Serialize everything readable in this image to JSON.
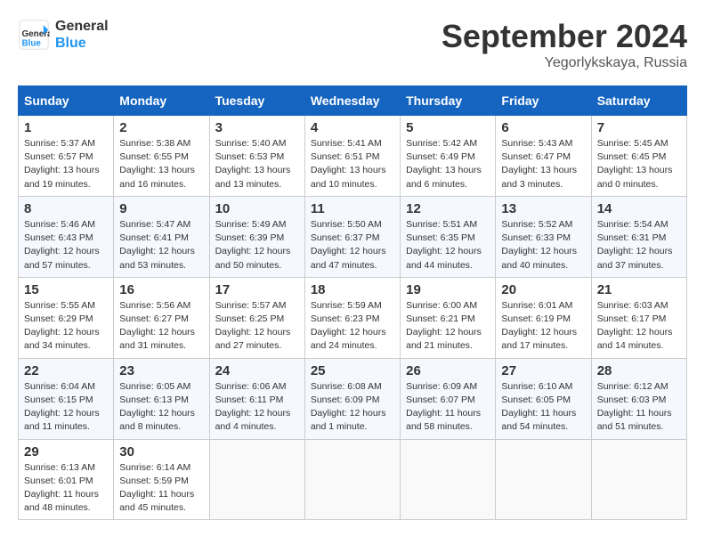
{
  "logo": {
    "text_general": "General",
    "text_blue": "Blue"
  },
  "title": "September 2024",
  "location": "Yegorlykskaya, Russia",
  "days_of_week": [
    "Sunday",
    "Monday",
    "Tuesday",
    "Wednesday",
    "Thursday",
    "Friday",
    "Saturday"
  ],
  "weeks": [
    [
      {
        "day": "1",
        "info": "Sunrise: 5:37 AM\nSunset: 6:57 PM\nDaylight: 13 hours and 19 minutes."
      },
      {
        "day": "2",
        "info": "Sunrise: 5:38 AM\nSunset: 6:55 PM\nDaylight: 13 hours and 16 minutes."
      },
      {
        "day": "3",
        "info": "Sunrise: 5:40 AM\nSunset: 6:53 PM\nDaylight: 13 hours and 13 minutes."
      },
      {
        "day": "4",
        "info": "Sunrise: 5:41 AM\nSunset: 6:51 PM\nDaylight: 13 hours and 10 minutes."
      },
      {
        "day": "5",
        "info": "Sunrise: 5:42 AM\nSunset: 6:49 PM\nDaylight: 13 hours and 6 minutes."
      },
      {
        "day": "6",
        "info": "Sunrise: 5:43 AM\nSunset: 6:47 PM\nDaylight: 13 hours and 3 minutes."
      },
      {
        "day": "7",
        "info": "Sunrise: 5:45 AM\nSunset: 6:45 PM\nDaylight: 13 hours and 0 minutes."
      }
    ],
    [
      {
        "day": "8",
        "info": "Sunrise: 5:46 AM\nSunset: 6:43 PM\nDaylight: 12 hours and 57 minutes."
      },
      {
        "day": "9",
        "info": "Sunrise: 5:47 AM\nSunset: 6:41 PM\nDaylight: 12 hours and 53 minutes."
      },
      {
        "day": "10",
        "info": "Sunrise: 5:49 AM\nSunset: 6:39 PM\nDaylight: 12 hours and 50 minutes."
      },
      {
        "day": "11",
        "info": "Sunrise: 5:50 AM\nSunset: 6:37 PM\nDaylight: 12 hours and 47 minutes."
      },
      {
        "day": "12",
        "info": "Sunrise: 5:51 AM\nSunset: 6:35 PM\nDaylight: 12 hours and 44 minutes."
      },
      {
        "day": "13",
        "info": "Sunrise: 5:52 AM\nSunset: 6:33 PM\nDaylight: 12 hours and 40 minutes."
      },
      {
        "day": "14",
        "info": "Sunrise: 5:54 AM\nSunset: 6:31 PM\nDaylight: 12 hours and 37 minutes."
      }
    ],
    [
      {
        "day": "15",
        "info": "Sunrise: 5:55 AM\nSunset: 6:29 PM\nDaylight: 12 hours and 34 minutes."
      },
      {
        "day": "16",
        "info": "Sunrise: 5:56 AM\nSunset: 6:27 PM\nDaylight: 12 hours and 31 minutes."
      },
      {
        "day": "17",
        "info": "Sunrise: 5:57 AM\nSunset: 6:25 PM\nDaylight: 12 hours and 27 minutes."
      },
      {
        "day": "18",
        "info": "Sunrise: 5:59 AM\nSunset: 6:23 PM\nDaylight: 12 hours and 24 minutes."
      },
      {
        "day": "19",
        "info": "Sunrise: 6:00 AM\nSunset: 6:21 PM\nDaylight: 12 hours and 21 minutes."
      },
      {
        "day": "20",
        "info": "Sunrise: 6:01 AM\nSunset: 6:19 PM\nDaylight: 12 hours and 17 minutes."
      },
      {
        "day": "21",
        "info": "Sunrise: 6:03 AM\nSunset: 6:17 PM\nDaylight: 12 hours and 14 minutes."
      }
    ],
    [
      {
        "day": "22",
        "info": "Sunrise: 6:04 AM\nSunset: 6:15 PM\nDaylight: 12 hours and 11 minutes."
      },
      {
        "day": "23",
        "info": "Sunrise: 6:05 AM\nSunset: 6:13 PM\nDaylight: 12 hours and 8 minutes."
      },
      {
        "day": "24",
        "info": "Sunrise: 6:06 AM\nSunset: 6:11 PM\nDaylight: 12 hours and 4 minutes."
      },
      {
        "day": "25",
        "info": "Sunrise: 6:08 AM\nSunset: 6:09 PM\nDaylight: 12 hours and 1 minute."
      },
      {
        "day": "26",
        "info": "Sunrise: 6:09 AM\nSunset: 6:07 PM\nDaylight: 11 hours and 58 minutes."
      },
      {
        "day": "27",
        "info": "Sunrise: 6:10 AM\nSunset: 6:05 PM\nDaylight: 11 hours and 54 minutes."
      },
      {
        "day": "28",
        "info": "Sunrise: 6:12 AM\nSunset: 6:03 PM\nDaylight: 11 hours and 51 minutes."
      }
    ],
    [
      {
        "day": "29",
        "info": "Sunrise: 6:13 AM\nSunset: 6:01 PM\nDaylight: 11 hours and 48 minutes."
      },
      {
        "day": "30",
        "info": "Sunrise: 6:14 AM\nSunset: 5:59 PM\nDaylight: 11 hours and 45 minutes."
      },
      {
        "day": "",
        "info": ""
      },
      {
        "day": "",
        "info": ""
      },
      {
        "day": "",
        "info": ""
      },
      {
        "day": "",
        "info": ""
      },
      {
        "day": "",
        "info": ""
      }
    ]
  ]
}
